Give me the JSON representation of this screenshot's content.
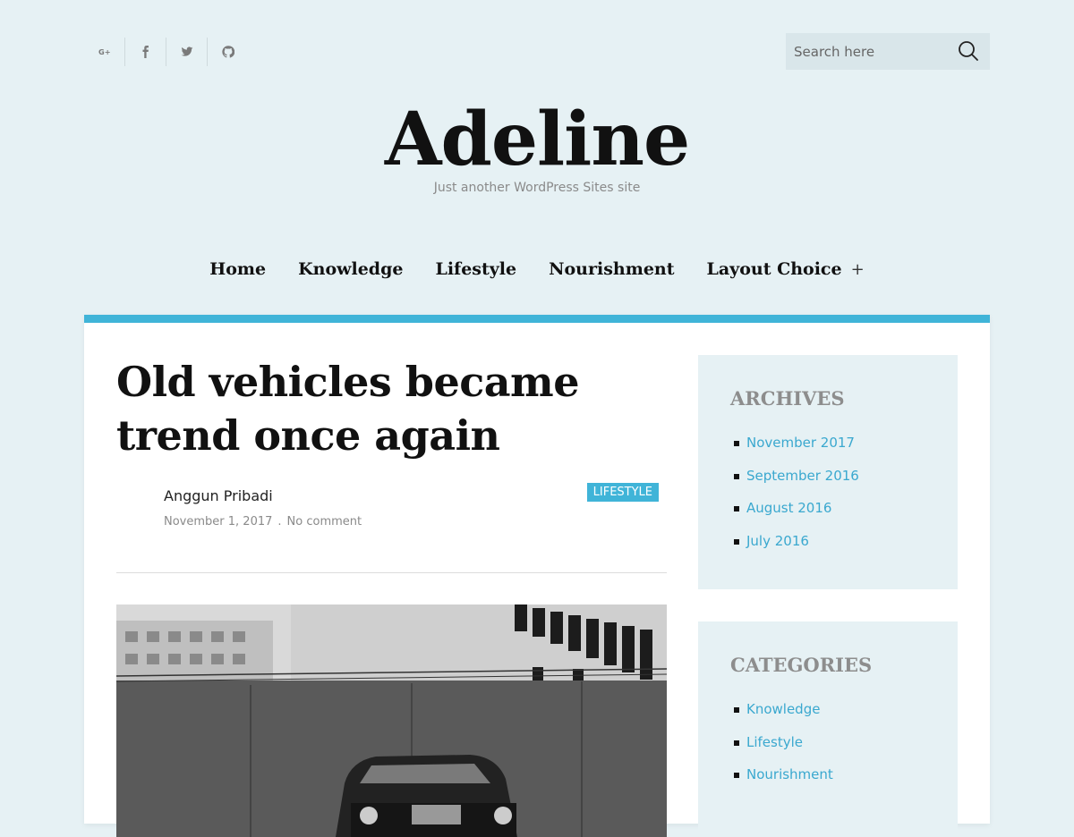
{
  "social": [
    {
      "name": "google-plus-icon"
    },
    {
      "name": "facebook-icon"
    },
    {
      "name": "twitter-icon"
    },
    {
      "name": "github-icon"
    }
  ],
  "search": {
    "placeholder": "Search here"
  },
  "site": {
    "title": "Adeline",
    "tagline": "Just another WordPress Sites site"
  },
  "nav": {
    "items": [
      "Home",
      "Knowledge",
      "Lifestyle",
      "Nourishment",
      "Layout Choice"
    ],
    "submenu_indicator": "+"
  },
  "post": {
    "title": "Old vehicles became trend once again",
    "author": "Anggun Pribadi",
    "date": "November 1, 2017",
    "separator": ".",
    "comments": "No comment",
    "category": "LIFESTYLE"
  },
  "sidebar": {
    "archives": {
      "title": "ARCHIVES",
      "items": [
        "November 2017",
        "September 2016",
        "August 2016",
        "July 2016"
      ]
    },
    "categories": {
      "title": "CATEGORIES",
      "items": [
        "Knowledge",
        "Lifestyle",
        "Nourishment"
      ]
    }
  },
  "colors": {
    "accent": "#40b4d8",
    "background": "#e6f1f4",
    "link": "#3aa8cf"
  }
}
